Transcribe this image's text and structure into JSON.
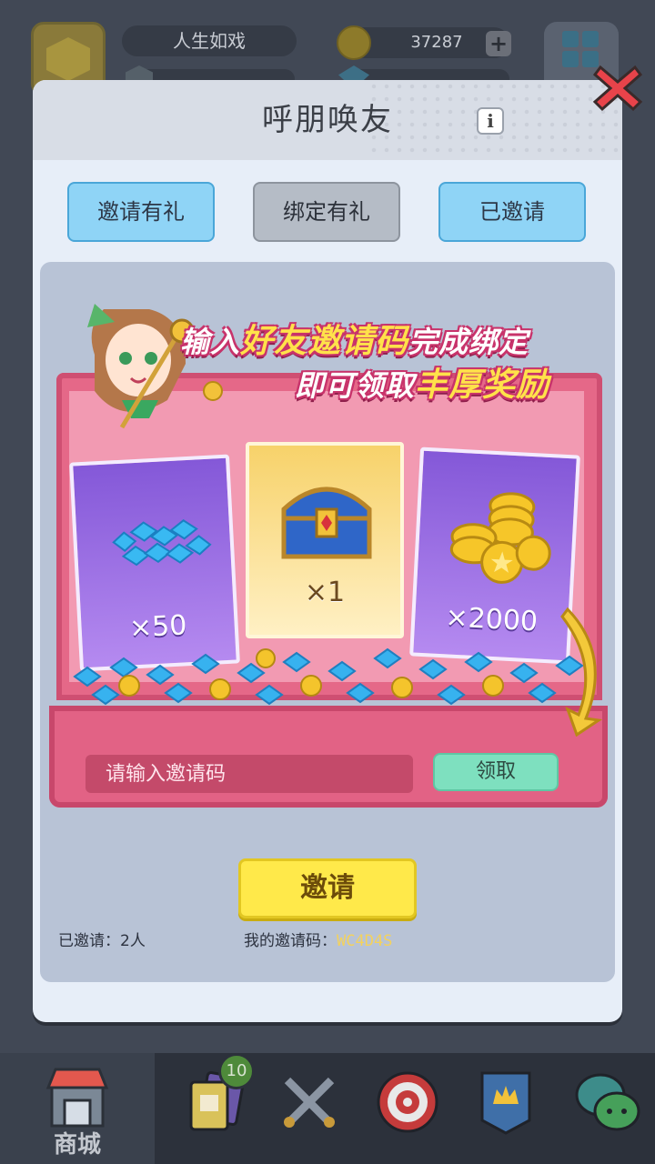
{
  "background": {
    "player_name": "人生如戏",
    "coins": "37287"
  },
  "dialog": {
    "title": "呼朋唤友",
    "tabs": [
      {
        "label": "邀请有礼"
      },
      {
        "label": "绑定有礼"
      },
      {
        "label": "已邀请"
      }
    ],
    "banner": {
      "line1_a": "输入",
      "line1_highlight": "好友邀请码",
      "line1_b": "完成绑定",
      "line2_a": "即可领取",
      "line2_highlight": "丰厚奖励",
      "rewards": [
        {
          "icon": "gem-pile-icon",
          "qty": "×50"
        },
        {
          "icon": "treasure-chest-icon",
          "qty": "×1"
        },
        {
          "icon": "coin-stack-icon",
          "qty": "×2000"
        }
      ]
    },
    "code_input": {
      "placeholder": "请输入邀请码",
      "value": ""
    },
    "claim_label": "领取",
    "invite_label": "邀请",
    "invited_count": "已邀请：2人",
    "my_code_label": "我的邀请码：",
    "my_code": "WC4D4S"
  },
  "bottom_nav": {
    "items": [
      {
        "icon": "shop-icon",
        "label": "商城"
      },
      {
        "icon": "cards-icon",
        "label": ""
      },
      {
        "icon": "crossed-swords-icon",
        "label": ""
      },
      {
        "icon": "target-icon",
        "label": ""
      },
      {
        "icon": "guild-banner-icon",
        "label": ""
      },
      {
        "icon": "chat-icon",
        "label": ""
      }
    ],
    "badge": "10"
  },
  "colors": {
    "tab_active": "#8fd4f6",
    "tab_inactive": "#b5bcc6",
    "invite_button": "#ffe94a",
    "claim_button": "#7ee0bf",
    "banner_pink": "#e56888",
    "invite_code": "#f4d25b"
  }
}
